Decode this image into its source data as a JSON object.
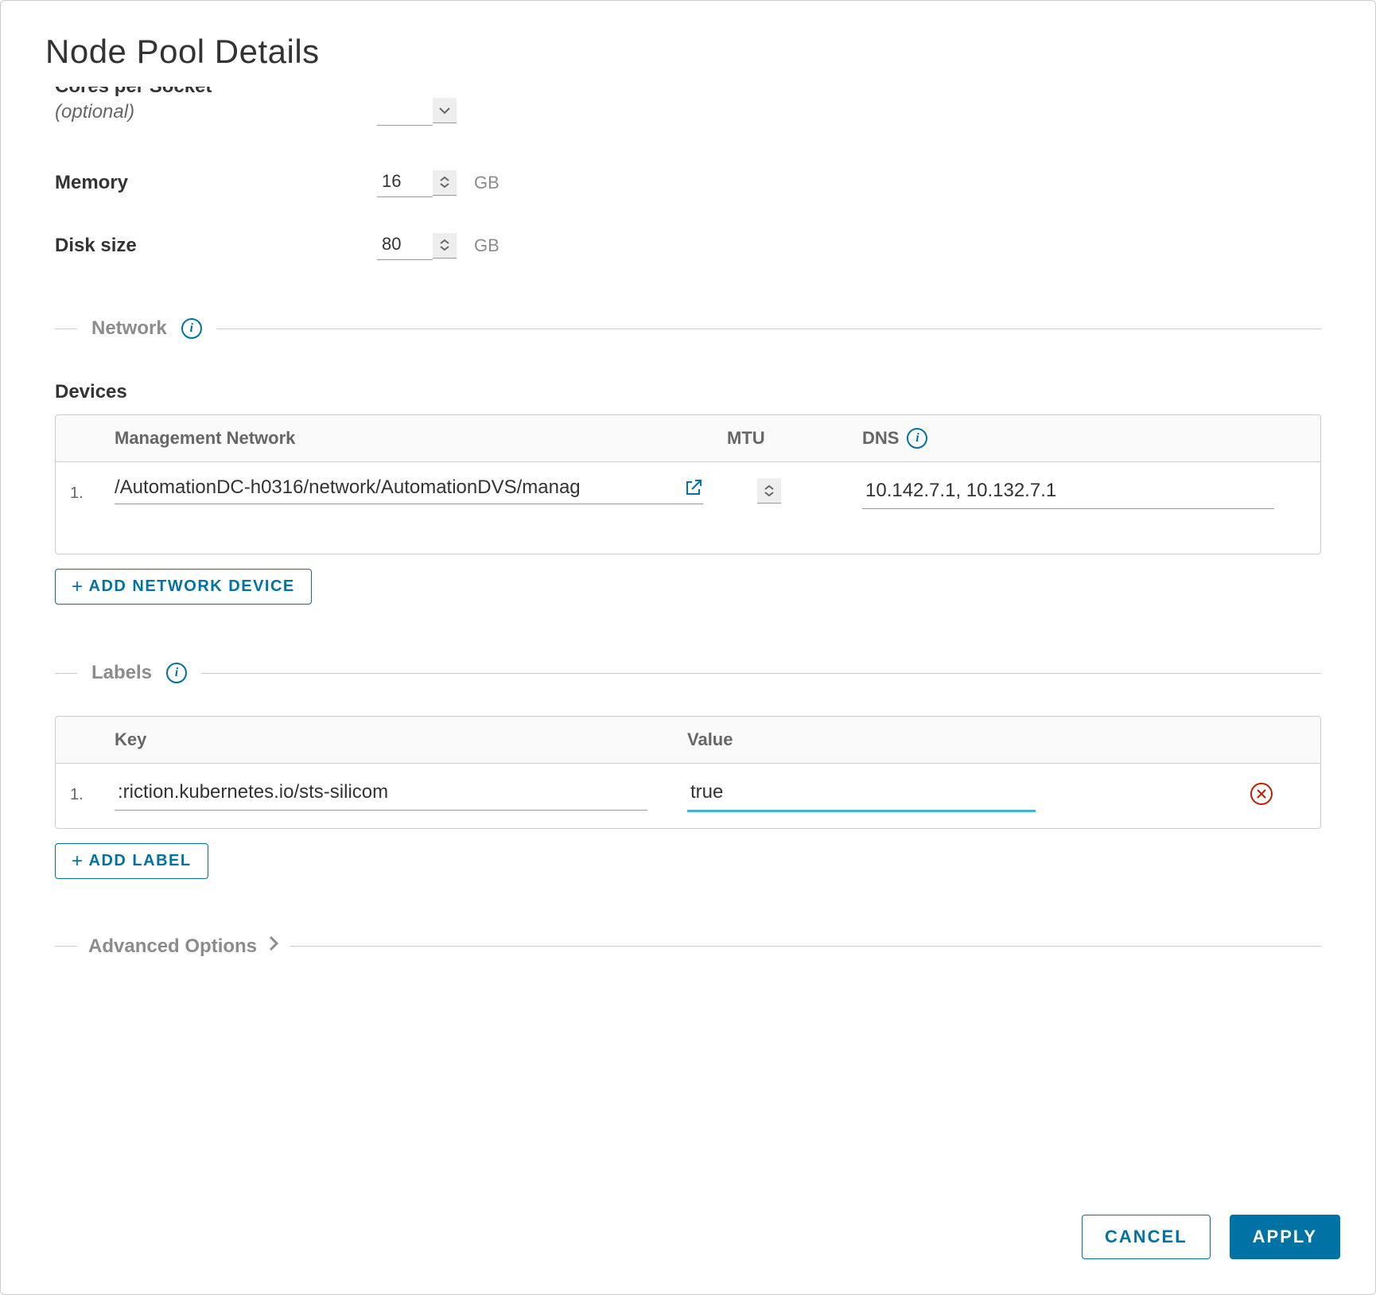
{
  "title": "Node Pool Details",
  "form": {
    "cores_per_socket": {
      "label": "Cores per Socket",
      "optional": "(optional)",
      "value": ""
    },
    "memory": {
      "label": "Memory",
      "value": "16",
      "unit": "GB"
    },
    "disk_size": {
      "label": "Disk size",
      "value": "80",
      "unit": "GB"
    }
  },
  "network": {
    "section_title": "Network",
    "devices_heading": "Devices",
    "columns": {
      "management": "Management Network",
      "mtu": "MTU",
      "dns": "DNS"
    },
    "rows": [
      {
        "index": "1.",
        "network_path": "/AutomationDC-h0316/network/AutomationDVS/manag",
        "mtu": "",
        "dns": "10.142.7.1, 10.132.7.1"
      }
    ],
    "add_button": "ADD NETWORK DEVICE"
  },
  "labels": {
    "section_title": "Labels",
    "columns": {
      "key": "Key",
      "value": "Value"
    },
    "rows": [
      {
        "index": "1.",
        "key": ":riction.kubernetes.io/sts-silicom",
        "value": "true"
      }
    ],
    "add_button": "ADD LABEL"
  },
  "advanced": {
    "title": "Advanced Options"
  },
  "footer": {
    "cancel": "CANCEL",
    "apply": "APPLY"
  }
}
